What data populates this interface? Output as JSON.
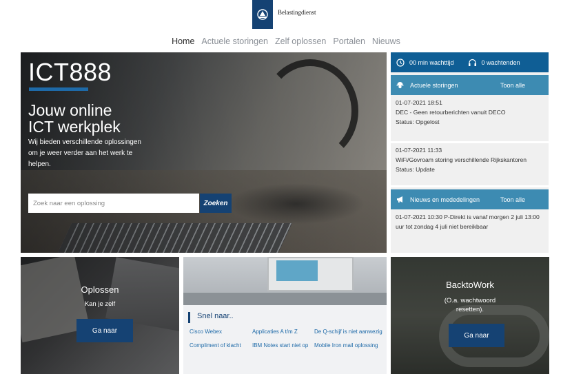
{
  "header": {
    "logo_name": "Belastingdienst",
    "logo_icon": "crest-icon"
  },
  "nav": {
    "items": [
      "Home",
      "Actuele storingen",
      "Zelf oplossen",
      "Portalen",
      "Nieuws"
    ],
    "active": "Home"
  },
  "hero": {
    "brand": "ICT888",
    "title_line1": "Jouw online",
    "title_line2": "ICT werkplek",
    "subtitle": "Wij bieden verschillende oplossingen om je weer verder aan het werk te helpen.",
    "search_placeholder": "Zoek naar een oplossing",
    "search_button": "Zoeken"
  },
  "status": {
    "wait_time": "00 min wachttijd",
    "waiting": "0 wachtenden"
  },
  "storingen": {
    "title": "Actuele storingen",
    "link": "Toon alle",
    "items": [
      {
        "date": "01-07-2021 18:51",
        "text": "DEC - Geen retourberichten vanuit DECO",
        "status": "Status: Opgelost"
      },
      {
        "date": "01-07-2021 11:33",
        "text": "WiFi/Govroam storing verschillende Rijkskantoren",
        "status": "Status: Update"
      }
    ]
  },
  "nieuws": {
    "title": "Nieuws en mededelingen",
    "link": "Toon alle",
    "items": [
      {
        "text": "01-07-2021 10:30 P-Direkt is vanaf morgen 2 juli 13:00 uur tot zondag 4 juli niet bereikbaar"
      }
    ]
  },
  "tile_oplossen": {
    "title": "Oplossen",
    "subtitle": "Kan je zelf",
    "button": "Ga naar"
  },
  "tile_snel": {
    "title": "Snel naar..",
    "links": [
      "Cisco Webex",
      "Applicaties A t/m Z",
      "De Q-schijf is niet aanwezig",
      "Compliment of klacht",
      "IBM Notes start niet op",
      "Mobile Iron mail oplossing"
    ]
  },
  "tile_back": {
    "title": "BacktoWork",
    "subtitle": "(O.a. wachtwoord resetten).",
    "button": "Ga naar"
  },
  "colors": {
    "primary": "#154273",
    "accent_bar": "#0f5e95",
    "section_bar": "#3d8bb2",
    "link": "#1e6aa8"
  }
}
